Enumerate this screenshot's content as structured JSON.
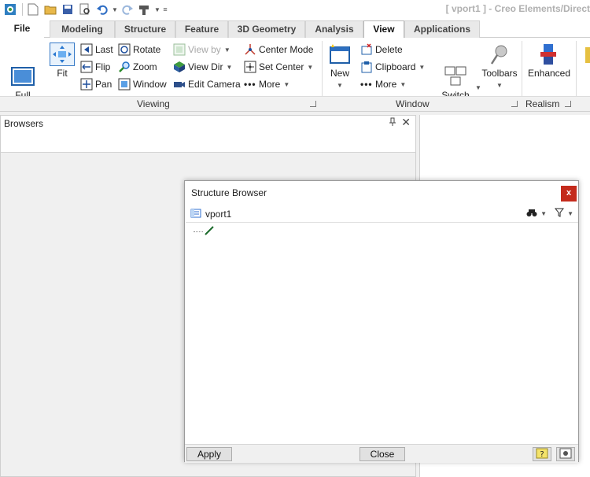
{
  "window": {
    "title": "[ vport1 ] - Creo Elements/Direct"
  },
  "tabs": [
    {
      "label": "File"
    },
    {
      "label": "Modeling"
    },
    {
      "label": "Structure"
    },
    {
      "label": "Feature"
    },
    {
      "label": "3D Geometry"
    },
    {
      "label": "Analysis"
    },
    {
      "label": "View"
    },
    {
      "label": "Applications"
    }
  ],
  "ribbon": {
    "viewing": {
      "label": "Viewing",
      "full_screen": "Full\nScreen",
      "fit": "Fit",
      "last": "Last",
      "flip": "Flip",
      "pan": "Pan",
      "rotate": "Rotate",
      "zoom": "Zoom",
      "window": "Window",
      "view_by": "View by",
      "view_dir": "View Dir",
      "edit_camera": "Edit Camera",
      "center_mode": "Center Mode",
      "set_center": "Set Center",
      "more": "More"
    },
    "window": {
      "label": "Window",
      "new": "New",
      "delete": "Delete",
      "clipboard": "Clipboard",
      "more": "More",
      "switch_windows": "Switch\nWindows",
      "toolbars": "Toolbars"
    },
    "realism": {
      "label": "Realism",
      "enhanced": "Enhanced"
    }
  },
  "browsers": {
    "title": "Browsers"
  },
  "structure_browser": {
    "title": "Structure Browser",
    "root": "vport1",
    "apply": "Apply",
    "close": "Close"
  }
}
